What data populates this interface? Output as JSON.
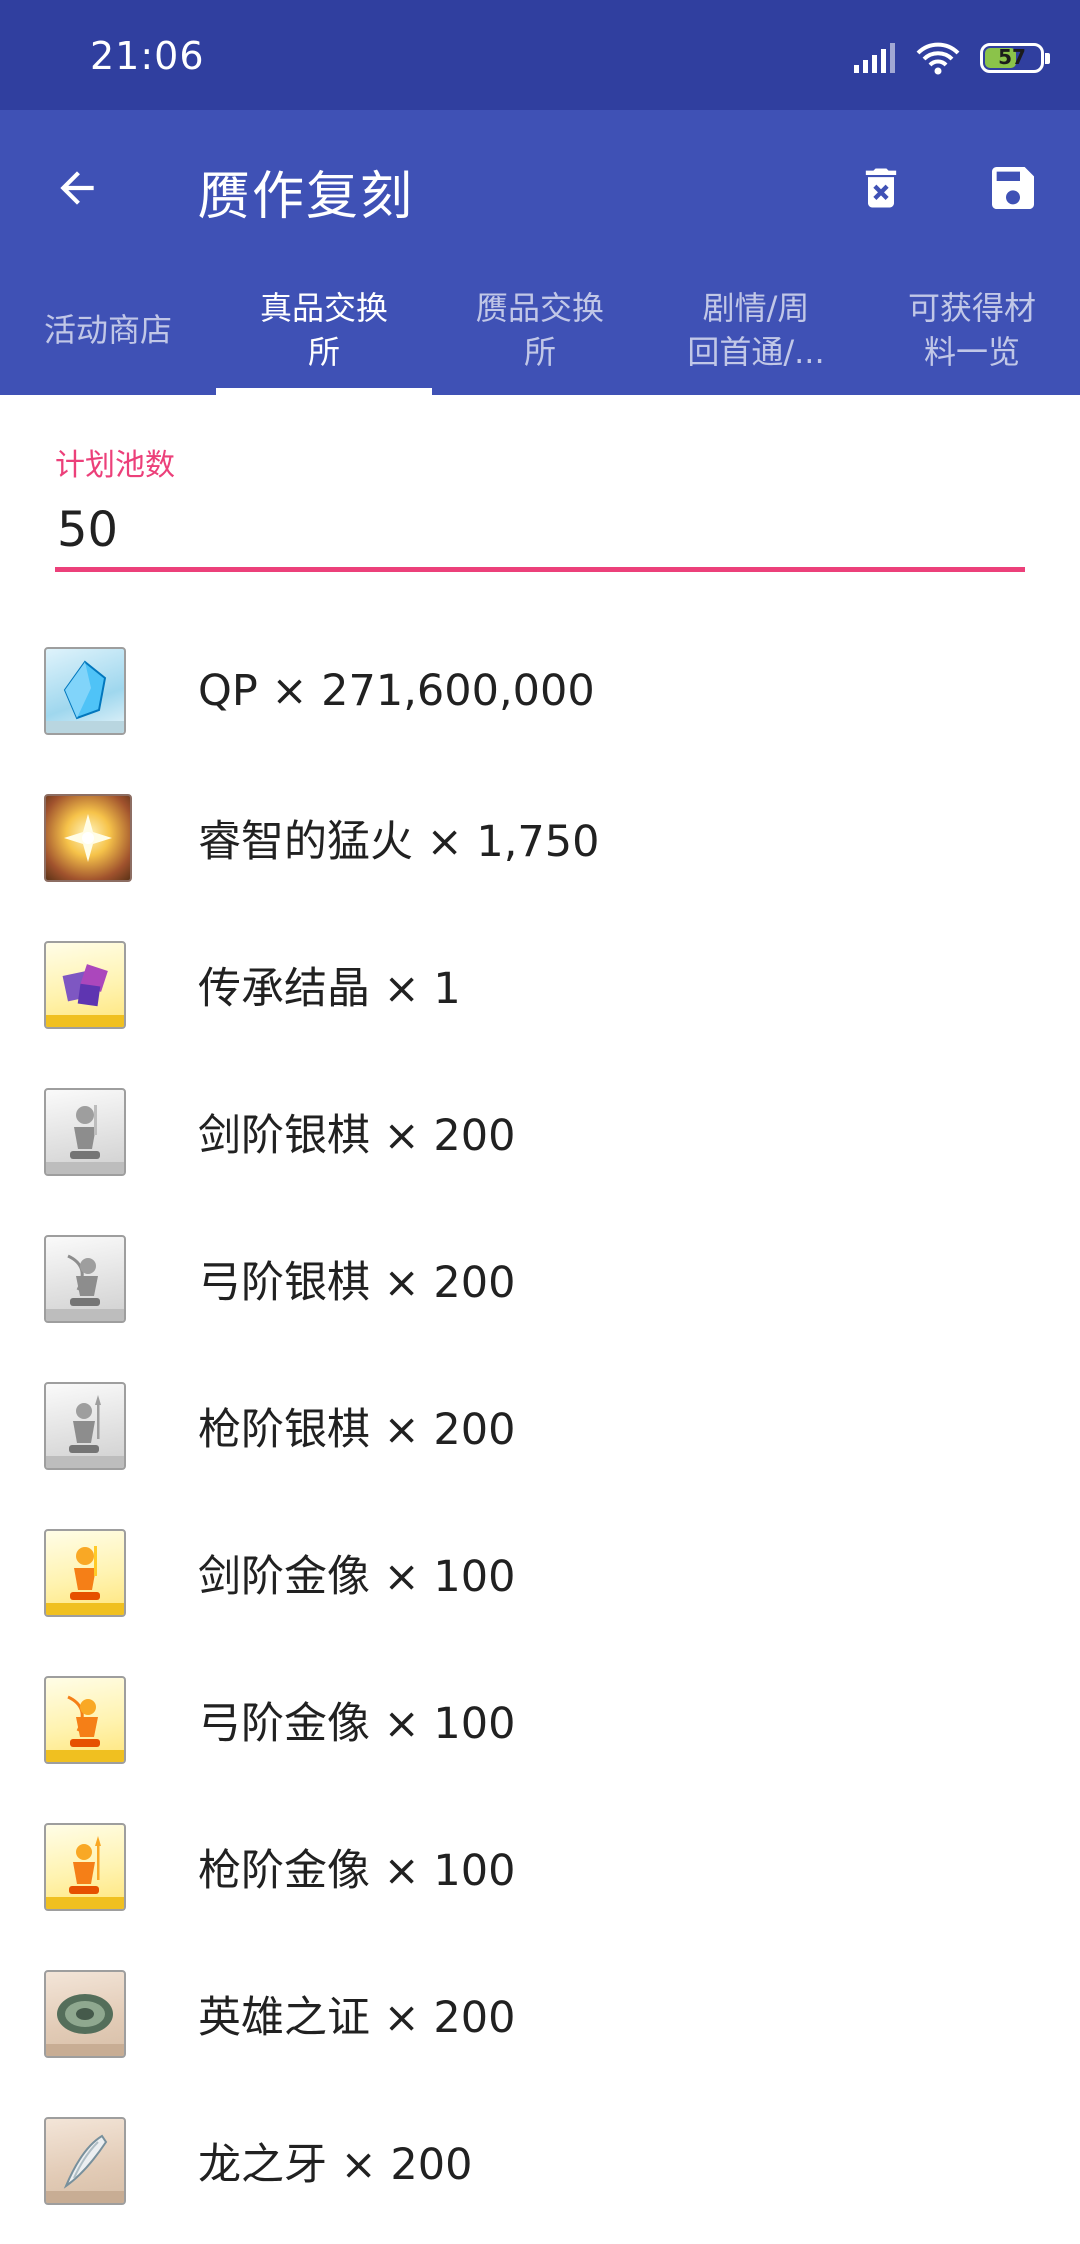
{
  "status_bar": {
    "time": "21:06",
    "battery": "57",
    "battery_fraction": 0.57
  },
  "app_bar": {
    "title": "赝作复刻",
    "icons": [
      "arrow-back-icon",
      "delete-icon",
      "save-icon"
    ]
  },
  "tabs": [
    {
      "label": "活动商店",
      "active": false
    },
    {
      "label": "真品交换\n所",
      "active": true
    },
    {
      "label": "赝品交换\n所",
      "active": false
    },
    {
      "label": "剧情/周\n回首通/...",
      "active": false
    },
    {
      "label": "可获得材\n料一览",
      "active": false
    }
  ],
  "pool_field": {
    "label": "计划池数",
    "value": "50"
  },
  "items": [
    {
      "text": "QP × 271,600,000",
      "icon": "qp-crystal-icon"
    },
    {
      "text": "睿智的猛火 × 1,750",
      "icon": "wisdom-fire-icon"
    },
    {
      "text": "传承结晶 × 1",
      "icon": "legacy-crystal-icon"
    },
    {
      "text": "剑阶银棋 × 200",
      "icon": "saber-silver-piece-icon"
    },
    {
      "text": "弓阶银棋 × 200",
      "icon": "archer-silver-piece-icon"
    },
    {
      "text": "枪阶银棋 × 200",
      "icon": "lancer-silver-piece-icon"
    },
    {
      "text": "剑阶金像 × 100",
      "icon": "saber-gold-statue-icon"
    },
    {
      "text": "弓阶金像 × 100",
      "icon": "archer-gold-statue-icon"
    },
    {
      "text": "枪阶金像 × 100",
      "icon": "lancer-gold-statue-icon"
    },
    {
      "text": "英雄之证 × 200",
      "icon": "hero-proof-icon"
    },
    {
      "text": "龙之牙 × 200",
      "icon": "dragon-fang-icon"
    }
  ],
  "colors": {
    "status_bar": "#303f9f",
    "primary": "#3f51b5",
    "accent": "#ec407a"
  }
}
